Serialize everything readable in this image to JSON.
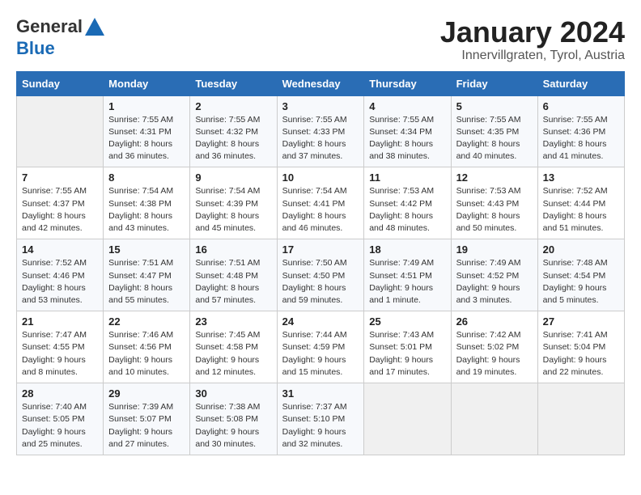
{
  "header": {
    "logo_general": "General",
    "logo_blue": "Blue",
    "month_year": "January 2024",
    "location": "Innervillgraten, Tyrol, Austria"
  },
  "weekdays": [
    "Sunday",
    "Monday",
    "Tuesday",
    "Wednesday",
    "Thursday",
    "Friday",
    "Saturday"
  ],
  "weeks": [
    [
      {
        "day": "",
        "detail": ""
      },
      {
        "day": "1",
        "detail": "Sunrise: 7:55 AM\nSunset: 4:31 PM\nDaylight: 8 hours\nand 36 minutes."
      },
      {
        "day": "2",
        "detail": "Sunrise: 7:55 AM\nSunset: 4:32 PM\nDaylight: 8 hours\nand 36 minutes."
      },
      {
        "day": "3",
        "detail": "Sunrise: 7:55 AM\nSunset: 4:33 PM\nDaylight: 8 hours\nand 37 minutes."
      },
      {
        "day": "4",
        "detail": "Sunrise: 7:55 AM\nSunset: 4:34 PM\nDaylight: 8 hours\nand 38 minutes."
      },
      {
        "day": "5",
        "detail": "Sunrise: 7:55 AM\nSunset: 4:35 PM\nDaylight: 8 hours\nand 40 minutes."
      },
      {
        "day": "6",
        "detail": "Sunrise: 7:55 AM\nSunset: 4:36 PM\nDaylight: 8 hours\nand 41 minutes."
      }
    ],
    [
      {
        "day": "7",
        "detail": "Sunrise: 7:55 AM\nSunset: 4:37 PM\nDaylight: 8 hours\nand 42 minutes."
      },
      {
        "day": "8",
        "detail": "Sunrise: 7:54 AM\nSunset: 4:38 PM\nDaylight: 8 hours\nand 43 minutes."
      },
      {
        "day": "9",
        "detail": "Sunrise: 7:54 AM\nSunset: 4:39 PM\nDaylight: 8 hours\nand 45 minutes."
      },
      {
        "day": "10",
        "detail": "Sunrise: 7:54 AM\nSunset: 4:41 PM\nDaylight: 8 hours\nand 46 minutes."
      },
      {
        "day": "11",
        "detail": "Sunrise: 7:53 AM\nSunset: 4:42 PM\nDaylight: 8 hours\nand 48 minutes."
      },
      {
        "day": "12",
        "detail": "Sunrise: 7:53 AM\nSunset: 4:43 PM\nDaylight: 8 hours\nand 50 minutes."
      },
      {
        "day": "13",
        "detail": "Sunrise: 7:52 AM\nSunset: 4:44 PM\nDaylight: 8 hours\nand 51 minutes."
      }
    ],
    [
      {
        "day": "14",
        "detail": "Sunrise: 7:52 AM\nSunset: 4:46 PM\nDaylight: 8 hours\nand 53 minutes."
      },
      {
        "day": "15",
        "detail": "Sunrise: 7:51 AM\nSunset: 4:47 PM\nDaylight: 8 hours\nand 55 minutes."
      },
      {
        "day": "16",
        "detail": "Sunrise: 7:51 AM\nSunset: 4:48 PM\nDaylight: 8 hours\nand 57 minutes."
      },
      {
        "day": "17",
        "detail": "Sunrise: 7:50 AM\nSunset: 4:50 PM\nDaylight: 8 hours\nand 59 minutes."
      },
      {
        "day": "18",
        "detail": "Sunrise: 7:49 AM\nSunset: 4:51 PM\nDaylight: 9 hours\nand 1 minute."
      },
      {
        "day": "19",
        "detail": "Sunrise: 7:49 AM\nSunset: 4:52 PM\nDaylight: 9 hours\nand 3 minutes."
      },
      {
        "day": "20",
        "detail": "Sunrise: 7:48 AM\nSunset: 4:54 PM\nDaylight: 9 hours\nand 5 minutes."
      }
    ],
    [
      {
        "day": "21",
        "detail": "Sunrise: 7:47 AM\nSunset: 4:55 PM\nDaylight: 9 hours\nand 8 minutes."
      },
      {
        "day": "22",
        "detail": "Sunrise: 7:46 AM\nSunset: 4:56 PM\nDaylight: 9 hours\nand 10 minutes."
      },
      {
        "day": "23",
        "detail": "Sunrise: 7:45 AM\nSunset: 4:58 PM\nDaylight: 9 hours\nand 12 minutes."
      },
      {
        "day": "24",
        "detail": "Sunrise: 7:44 AM\nSunset: 4:59 PM\nDaylight: 9 hours\nand 15 minutes."
      },
      {
        "day": "25",
        "detail": "Sunrise: 7:43 AM\nSunset: 5:01 PM\nDaylight: 9 hours\nand 17 minutes."
      },
      {
        "day": "26",
        "detail": "Sunrise: 7:42 AM\nSunset: 5:02 PM\nDaylight: 9 hours\nand 19 minutes."
      },
      {
        "day": "27",
        "detail": "Sunrise: 7:41 AM\nSunset: 5:04 PM\nDaylight: 9 hours\nand 22 minutes."
      }
    ],
    [
      {
        "day": "28",
        "detail": "Sunrise: 7:40 AM\nSunset: 5:05 PM\nDaylight: 9 hours\nand 25 minutes."
      },
      {
        "day": "29",
        "detail": "Sunrise: 7:39 AM\nSunset: 5:07 PM\nDaylight: 9 hours\nand 27 minutes."
      },
      {
        "day": "30",
        "detail": "Sunrise: 7:38 AM\nSunset: 5:08 PM\nDaylight: 9 hours\nand 30 minutes."
      },
      {
        "day": "31",
        "detail": "Sunrise: 7:37 AM\nSunset: 5:10 PM\nDaylight: 9 hours\nand 32 minutes."
      },
      {
        "day": "",
        "detail": ""
      },
      {
        "day": "",
        "detail": ""
      },
      {
        "day": "",
        "detail": ""
      }
    ]
  ]
}
